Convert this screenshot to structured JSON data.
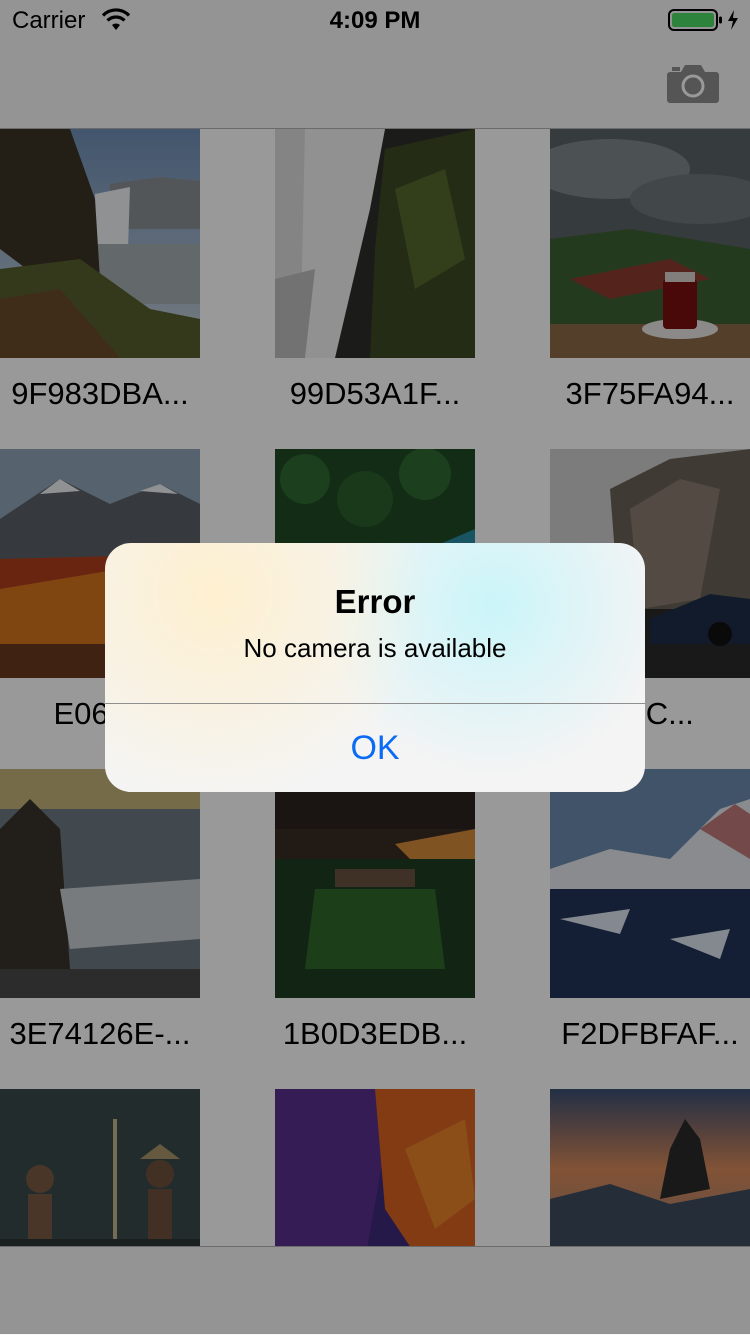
{
  "status_bar": {
    "carrier": "Carrier",
    "time": "4:09 PM"
  },
  "nav_bar": {
    "right_button_icon": "camera-icon"
  },
  "grid": {
    "items": [
      {
        "caption": "9F983DBA...",
        "thumb": "waterfall-cliffs"
      },
      {
        "caption": "99D53A1F...",
        "thumb": "waterfall-rocks"
      },
      {
        "caption": "3F75FA94...",
        "thumb": "tea-glass-valley"
      },
      {
        "caption": "E066A",
        "thumb": "autumn-mountains"
      },
      {
        "caption": "",
        "thumb": "forest-aerial"
      },
      {
        "caption": "9CC...",
        "thumb": "cliff-sports-car"
      },
      {
        "caption": "3E74126E-...",
        "thumb": "sea-stack-shore"
      },
      {
        "caption": "1B0D3EDB...",
        "thumb": "night-ruins"
      },
      {
        "caption": "F2DFBFAF...",
        "thumb": "snowy-lake-mountains"
      },
      {
        "caption": "",
        "thumb": "children-fishing"
      },
      {
        "caption": "",
        "thumb": "lion-painting"
      },
      {
        "caption": "",
        "thumb": "sunset-sea-rocks"
      }
    ]
  },
  "alert": {
    "title": "Error",
    "message": "No camera is available",
    "ok_label": "OK"
  },
  "colors": {
    "ios_blue": "#0a6cf5",
    "battery_green": "#4cd964"
  }
}
